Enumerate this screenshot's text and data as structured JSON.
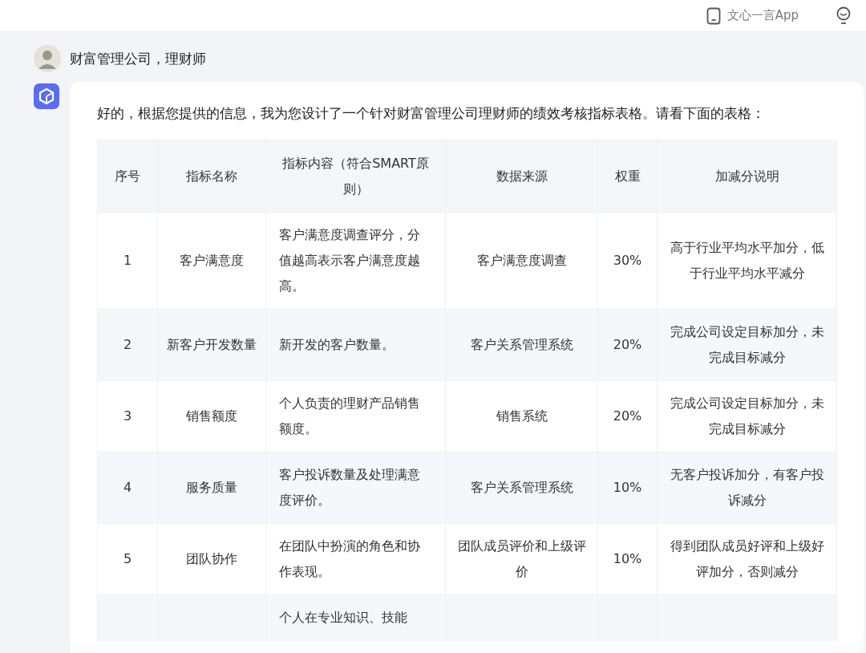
{
  "top_bar": {
    "app_link": "文心一言App"
  },
  "user_message": {
    "text": "财富管理公司，理财师"
  },
  "reply": {
    "intro": "好的，根据您提供的信息，我为您设计了一个针对财富管理公司理财师的绩效考核指标表格。请看下面的表格：",
    "table": {
      "columns": [
        "序号",
        "指标名称",
        "指标内容（符合SMART原则）",
        "数据来源",
        "权重",
        "加减分说明"
      ],
      "rows": [
        {
          "cells": [
            "1",
            "客户满意度",
            "客户满意度调查评分，分值越高表示客户满意度越高。",
            "客户满意度调查",
            "30%",
            "高于行业平均水平加分，低于行业平均水平减分"
          ]
        },
        {
          "cells": [
            "2",
            "新客户开发数量",
            "新开发的客户数量。",
            "客户关系管理系统",
            "20%",
            "完成公司设定目标加分，未完成目标减分"
          ]
        },
        {
          "cells": [
            "3",
            "销售额度",
            "个人负责的理财产品销售额度。",
            "销售系统",
            "20%",
            "完成公司设定目标加分，未完成目标减分"
          ]
        },
        {
          "cells": [
            "4",
            "服务质量",
            "客户投诉数量及处理满意度评价。",
            "客户关系管理系统",
            "10%",
            "无客户投诉加分，有客户投诉减分"
          ]
        },
        {
          "cells": [
            "5",
            "团队协作",
            "在团队中扮演的角色和协作表现。",
            "团队成员评价和上级评价",
            "10%",
            "得到团队成员好评和上级好评加分，否则减分"
          ]
        },
        {
          "cells": [
            "",
            "",
            "个人在专业知识、技能",
            "",
            "",
            ""
          ]
        }
      ]
    }
  }
}
